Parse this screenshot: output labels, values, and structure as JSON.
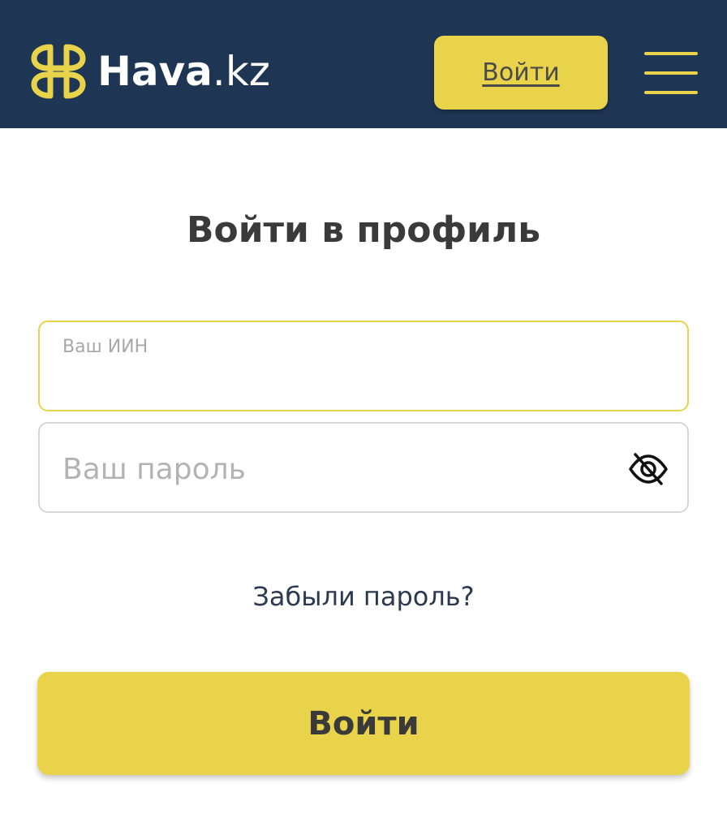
{
  "header": {
    "logo": {
      "brand": "Hava",
      "tld": ".kz"
    },
    "login_label": "Войти",
    "menu_icon": "hamburger-icon"
  },
  "page": {
    "title": "Войти в профиль"
  },
  "form": {
    "iin": {
      "label": "Ваш ИИН",
      "value": ""
    },
    "password": {
      "placeholder": "Ваш пароль",
      "value": "",
      "toggle_icon": "eye-off-icon"
    },
    "forgot_label": "Забыли пароль?",
    "submit_label": "Войти"
  },
  "colors": {
    "header_bg": "#1e3654",
    "accent": "#e8d34a",
    "text_dark": "#3a3a3a",
    "link": "#2b3a4e"
  }
}
